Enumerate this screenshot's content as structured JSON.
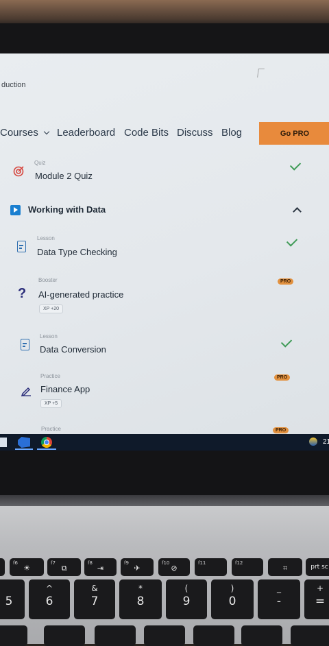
{
  "page": {
    "breadcrumb": "duction"
  },
  "nav": {
    "items": [
      "Courses",
      "Leaderboard",
      "Code Bits",
      "Discuss",
      "Blog"
    ],
    "go_pro": "Go PRO"
  },
  "module_quiz": {
    "kind": "Quiz",
    "title": "Module 2 Quiz",
    "completed": true
  },
  "section": {
    "title": "Working with Data",
    "expanded": true
  },
  "lessons": [
    {
      "kind": "Lesson",
      "title": "Data Type Checking",
      "completed": true
    },
    {
      "kind": "Booster",
      "title": "AI-generated practice",
      "badge": "PRO",
      "xp": "XP +20"
    },
    {
      "kind": "Lesson",
      "title": "Data Conversion",
      "completed": true
    },
    {
      "kind": "Practice",
      "title": "Finance App",
      "badge": "PRO",
      "xp": "XP +5"
    },
    {
      "kind": "Practice",
      "badge": "PRO"
    }
  ],
  "taskbar": {
    "time": "21"
  },
  "keyboard": {
    "fkeys": [
      {
        "label": "f6",
        "symbol": "☀"
      },
      {
        "label": "f7",
        "symbol": "⧉"
      },
      {
        "label": "f8",
        "symbol": "⇥"
      },
      {
        "label": "f9",
        "symbol": "✈"
      },
      {
        "label": "f10",
        "symbol": "⊘"
      },
      {
        "label": "f11",
        "symbol": ""
      },
      {
        "label": "f12",
        "symbol": ""
      },
      {
        "label": "",
        "symbol": "⌗"
      },
      {
        "label": "",
        "symbol": "prt sc"
      }
    ],
    "numkeys": [
      {
        "top": "",
        "main": "5"
      },
      {
        "top": "^",
        "main": "6"
      },
      {
        "top": "&",
        "main": "7"
      },
      {
        "top": "*",
        "main": "8"
      },
      {
        "top": "(",
        "main": "9"
      },
      {
        "top": ")",
        "main": "0"
      },
      {
        "top": "_",
        "main": "-"
      },
      {
        "top": "+",
        "main": "="
      }
    ]
  },
  "colors": {
    "accent_orange": "#e88a3c",
    "check_green": "#3d9a55",
    "play_blue": "#1a7fd0"
  }
}
